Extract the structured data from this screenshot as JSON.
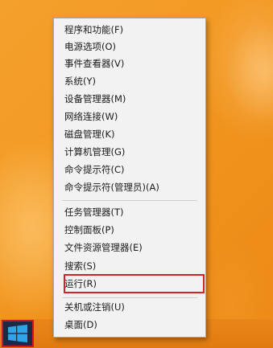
{
  "context_menu": {
    "group1": [
      "程序和功能(F)",
      "电源选项(O)",
      "事件查看器(V)",
      "系统(Y)",
      "设备管理器(M)",
      "网络连接(W)",
      "磁盘管理(K)",
      "计算机管理(G)",
      "命令提示符(C)",
      "命令提示符(管理员)(A)"
    ],
    "group2": [
      "任务管理器(T)",
      "控制面板(P)",
      "文件资源管理器(E)",
      "搜索(S)",
      "运行(R)"
    ],
    "group3": [
      "关机或注销(U)",
      "桌面(D)"
    ]
  },
  "taskbar": {
    "start_icon": "windows-logo-icon"
  },
  "colors": {
    "desktop": "#f39a24",
    "menu_bg": "#f2f2f2",
    "highlight_border": "#d6202a",
    "start_bg": "#1d2a44"
  }
}
